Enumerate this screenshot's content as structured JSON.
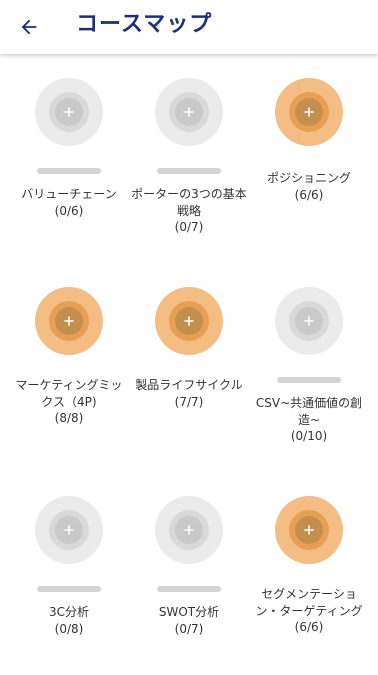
{
  "header": {
    "title": "コースマップ",
    "back_icon": "arrow-left-icon"
  },
  "courses": [
    {
      "name": "バリューチェーン",
      "count": "(0/6)",
      "progress": 0,
      "complete": false
    },
    {
      "name": "ポーターの3つの基本戦略",
      "count": "(0/7)",
      "progress": 0,
      "complete": false
    },
    {
      "name": "ポジショニング",
      "count": "(6/6)",
      "progress": 1,
      "complete": true
    },
    {
      "name": "マーケティングミックス（4P)",
      "count": "(8/8)",
      "progress": 1,
      "complete": true
    },
    {
      "name": "製品ライフサイクル",
      "count": "(7/7)",
      "progress": 1,
      "complete": true
    },
    {
      "name": "CSV~共通価値の創造~",
      "count": "(0/10)",
      "progress": 0,
      "complete": false
    },
    {
      "name": "3C分析",
      "count": "(0/8)",
      "progress": 0,
      "complete": false
    },
    {
      "name": "SWOT分析",
      "count": "(0/7)",
      "progress": 0,
      "complete": false
    },
    {
      "name": "セグメンテーション・ターゲティング",
      "count": "(6/6)",
      "progress": 1,
      "complete": true
    }
  ],
  "colors": {
    "title": "#1b2f7a",
    "incomplete_halo": "#ebebeb",
    "complete_halo": "#f3bd84"
  }
}
